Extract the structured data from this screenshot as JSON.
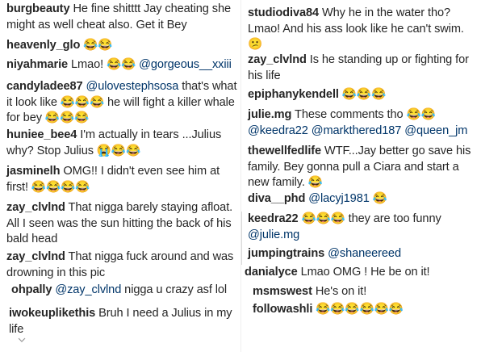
{
  "left_comments": [
    {
      "user": "burgbeauty",
      "parts": [
        {
          "t": "He fine shitttt Jay cheating she might as well cheat also. Get it Bey"
        }
      ]
    },
    {
      "user": "heavenly_glo",
      "parts": [
        {
          "t": "😂😂"
        }
      ]
    },
    {
      "user": "niyahmarie",
      "parts": [
        {
          "t": "Lmao! 😂😂 "
        },
        {
          "t": "@gorgeous__xxiii",
          "m": true
        }
      ]
    },
    {
      "user": "candyladee87",
      "parts": [
        {
          "t": "@ulovestephsosa",
          "m": true
        },
        {
          "t": " that's what it look like 😂😂😂 he will fight a killer whale for bey 😂😂😂"
        }
      ]
    },
    {
      "user": "huniee_bee4",
      "parts": [
        {
          "t": "I'm actually in tears ...Julius why? Stop Julius 😭😂😂"
        }
      ]
    },
    {
      "user": "jasminelh",
      "parts": [
        {
          "t": "OMG!! I didn't even see him at first! 😂😂😂😂"
        }
      ]
    },
    {
      "user": "zay_clvlnd",
      "parts": [
        {
          "t": "That nigga barely staying afloat. All I seen was the sun hitting the back of his bald head"
        }
      ]
    },
    {
      "user": "zay_clvlnd",
      "parts": [
        {
          "t": "That nigga fuck around and was drowning in this pic"
        }
      ]
    },
    {
      "user": "ohpally",
      "parts": [
        {
          "t": "@zay_clvlnd",
          "m": true
        },
        {
          "t": " nigga u crazy asf lol"
        }
      ]
    },
    {
      "user": "iwokeuplikethis",
      "parts": [
        {
          "t": "Bruh I need a Julius in my life"
        }
      ]
    }
  ],
  "right_comments": [
    {
      "user": "studiodiva84",
      "parts": [
        {
          "t": "Why he in the water tho? Lmao! And his ass look like he can't swim. 😕"
        }
      ]
    },
    {
      "user": "zay_clvlnd",
      "parts": [
        {
          "t": "Is he standing up or fighting for his life"
        }
      ]
    },
    {
      "user": "epiphanykendell",
      "parts": [
        {
          "t": "😂😂😂"
        }
      ]
    },
    {
      "user": "julie.mg",
      "parts": [
        {
          "t": "These comments tho 😂😂 "
        },
        {
          "t": "@keedra22",
          "m": true
        },
        {
          "t": " "
        },
        {
          "t": "@markthered187",
          "m": true
        },
        {
          "t": " "
        },
        {
          "t": "@queen_jm",
          "m": true
        }
      ]
    },
    {
      "user": "thewellfedlife",
      "parts": [
        {
          "t": "WTF...Jay better go save his family. Bey gonna pull a Ciara and start a new family. 😂"
        }
      ]
    },
    {
      "user": "diva__phd",
      "parts": [
        {
          "t": "@lacyj1981",
          "m": true
        },
        {
          "t": " 😂"
        }
      ]
    },
    {
      "user": "keedra22",
      "parts": [
        {
          "t": "😂😂😂 they are too funny "
        },
        {
          "t": "@julie.mg",
          "m": true
        }
      ]
    },
    {
      "user": "jumpingtrains",
      "parts": [
        {
          "t": "@shaneereed",
          "m": true
        }
      ]
    },
    {
      "user": "danialyce",
      "parts": [
        {
          "t": "Lmao OMG ! He be on it!"
        }
      ]
    },
    {
      "user": "msmswest",
      "parts": [
        {
          "t": "He's on it!"
        }
      ]
    },
    {
      "user": "followashli",
      "parts": [
        {
          "t": "😂😂😂😂😂😂"
        }
      ]
    }
  ]
}
